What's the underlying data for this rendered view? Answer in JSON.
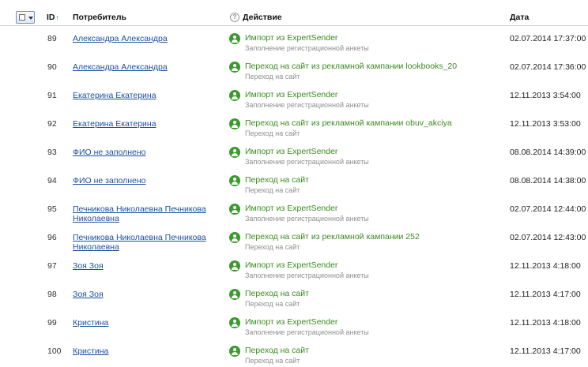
{
  "header": {
    "id_label": "ID",
    "sort_arrow": "↑",
    "consumer_label": "Потребитель",
    "help_glyph": "?",
    "action_label": "Действие",
    "date_label": "Дата"
  },
  "colors": {
    "action_green": "#3b8a1f",
    "link_blue": "#1a4f9c",
    "icon_green": "#3a9b2c",
    "subtext_gray": "#8f8f8f"
  },
  "rows": [
    {
      "id": "89",
      "consumer": "Александра Александра",
      "action": "Импорт из ExpertSender",
      "sub": "Заполнение регистрационной анкеты",
      "date": "02.07.2014 17:37:00"
    },
    {
      "id": "90",
      "consumer": "Александра Александра",
      "action": "Переход на сайт из рекламной кампании lookbooks_20",
      "sub": "Переход на сайт",
      "date": "02.07.2014 17:36:00"
    },
    {
      "id": "91",
      "consumer": "Екатерина Екатерина",
      "action": "Импорт из ExpertSender",
      "sub": "Заполнение регистрационной анкеты",
      "date": "12.11.2013 3:54:00"
    },
    {
      "id": "92",
      "consumer": "Екатерина Екатерина",
      "action": "Переход на сайт из рекламной кампании obuv_akciya",
      "sub": "Переход на сайт",
      "date": "12.11.2013 3:53:00"
    },
    {
      "id": "93",
      "consumer": "ФИО не заполнено",
      "action": "Импорт из ExpertSender",
      "sub": "Заполнение регистрационной анкеты",
      "date": "08.08.2014 14:39:00"
    },
    {
      "id": "94",
      "consumer": "ФИО не заполнено",
      "action": "Переход на сайт",
      "sub": "Переход на сайт",
      "date": "08.08.2014 14:38:00"
    },
    {
      "id": "95",
      "consumer": "Печникова Николаевна Печникова Николаевна",
      "action": "Импорт из ExpertSender",
      "sub": "Заполнение регистрационной анкеты",
      "date": "02.07.2014 12:44:00"
    },
    {
      "id": "96",
      "consumer": "Печникова Николаевна Печникова Николаевна",
      "action": "Переход на сайт из рекламной кампании 252",
      "sub": "Переход на сайт",
      "date": "02.07.2014 12:43:00"
    },
    {
      "id": "97",
      "consumer": "Зоя Зоя",
      "action": "Импорт из ExpertSender",
      "sub": "Заполнение регистрационной анкеты",
      "date": "12.11.2013 4:18:00"
    },
    {
      "id": "98",
      "consumer": "Зоя Зоя",
      "action": "Переход на сайт",
      "sub": "Переход на сайт",
      "date": "12.11.2013 4:17:00"
    },
    {
      "id": "99",
      "consumer": "Кристина",
      "action": "Импорт из ExpertSender",
      "sub": "Заполнение регистрационной анкеты",
      "date": "12.11.2013 4:18:00"
    },
    {
      "id": "100",
      "consumer": "Кристина",
      "action": "Переход на сайт",
      "sub": "Переход на сайт",
      "date": "12.11.2013 4:17:00"
    }
  ]
}
